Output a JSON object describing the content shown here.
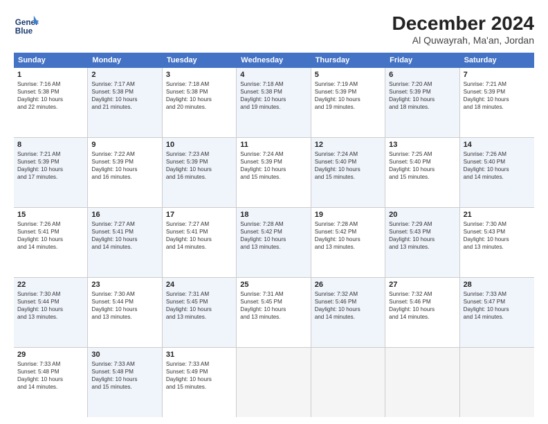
{
  "header": {
    "logo_line1": "General",
    "logo_line2": "Blue",
    "title": "December 2024",
    "subtitle": "Al Quwayrah, Ma'an, Jordan"
  },
  "days_of_week": [
    "Sunday",
    "Monday",
    "Tuesday",
    "Wednesday",
    "Thursday",
    "Friday",
    "Saturday"
  ],
  "weeks": [
    [
      {
        "day": "1",
        "text": "Sunrise: 7:16 AM\nSunset: 5:38 PM\nDaylight: 10 hours\nand 22 minutes.",
        "alt": false
      },
      {
        "day": "2",
        "text": "Sunrise: 7:17 AM\nSunset: 5:38 PM\nDaylight: 10 hours\nand 21 minutes.",
        "alt": true
      },
      {
        "day": "3",
        "text": "Sunrise: 7:18 AM\nSunset: 5:38 PM\nDaylight: 10 hours\nand 20 minutes.",
        "alt": false
      },
      {
        "day": "4",
        "text": "Sunrise: 7:18 AM\nSunset: 5:38 PM\nDaylight: 10 hours\nand 19 minutes.",
        "alt": true
      },
      {
        "day": "5",
        "text": "Sunrise: 7:19 AM\nSunset: 5:39 PM\nDaylight: 10 hours\nand 19 minutes.",
        "alt": false
      },
      {
        "day": "6",
        "text": "Sunrise: 7:20 AM\nSunset: 5:39 PM\nDaylight: 10 hours\nand 18 minutes.",
        "alt": true
      },
      {
        "day": "7",
        "text": "Sunrise: 7:21 AM\nSunset: 5:39 PM\nDaylight: 10 hours\nand 18 minutes.",
        "alt": false
      }
    ],
    [
      {
        "day": "8",
        "text": "Sunrise: 7:21 AM\nSunset: 5:39 PM\nDaylight: 10 hours\nand 17 minutes.",
        "alt": true
      },
      {
        "day": "9",
        "text": "Sunrise: 7:22 AM\nSunset: 5:39 PM\nDaylight: 10 hours\nand 16 minutes.",
        "alt": false
      },
      {
        "day": "10",
        "text": "Sunrise: 7:23 AM\nSunset: 5:39 PM\nDaylight: 10 hours\nand 16 minutes.",
        "alt": true
      },
      {
        "day": "11",
        "text": "Sunrise: 7:24 AM\nSunset: 5:39 PM\nDaylight: 10 hours\nand 15 minutes.",
        "alt": false
      },
      {
        "day": "12",
        "text": "Sunrise: 7:24 AM\nSunset: 5:40 PM\nDaylight: 10 hours\nand 15 minutes.",
        "alt": true
      },
      {
        "day": "13",
        "text": "Sunrise: 7:25 AM\nSunset: 5:40 PM\nDaylight: 10 hours\nand 15 minutes.",
        "alt": false
      },
      {
        "day": "14",
        "text": "Sunrise: 7:26 AM\nSunset: 5:40 PM\nDaylight: 10 hours\nand 14 minutes.",
        "alt": true
      }
    ],
    [
      {
        "day": "15",
        "text": "Sunrise: 7:26 AM\nSunset: 5:41 PM\nDaylight: 10 hours\nand 14 minutes.",
        "alt": false
      },
      {
        "day": "16",
        "text": "Sunrise: 7:27 AM\nSunset: 5:41 PM\nDaylight: 10 hours\nand 14 minutes.",
        "alt": true
      },
      {
        "day": "17",
        "text": "Sunrise: 7:27 AM\nSunset: 5:41 PM\nDaylight: 10 hours\nand 14 minutes.",
        "alt": false
      },
      {
        "day": "18",
        "text": "Sunrise: 7:28 AM\nSunset: 5:42 PM\nDaylight: 10 hours\nand 13 minutes.",
        "alt": true
      },
      {
        "day": "19",
        "text": "Sunrise: 7:28 AM\nSunset: 5:42 PM\nDaylight: 10 hours\nand 13 minutes.",
        "alt": false
      },
      {
        "day": "20",
        "text": "Sunrise: 7:29 AM\nSunset: 5:43 PM\nDaylight: 10 hours\nand 13 minutes.",
        "alt": true
      },
      {
        "day": "21",
        "text": "Sunrise: 7:30 AM\nSunset: 5:43 PM\nDaylight: 10 hours\nand 13 minutes.",
        "alt": false
      }
    ],
    [
      {
        "day": "22",
        "text": "Sunrise: 7:30 AM\nSunset: 5:44 PM\nDaylight: 10 hours\nand 13 minutes.",
        "alt": true
      },
      {
        "day": "23",
        "text": "Sunrise: 7:30 AM\nSunset: 5:44 PM\nDaylight: 10 hours\nand 13 minutes.",
        "alt": false
      },
      {
        "day": "24",
        "text": "Sunrise: 7:31 AM\nSunset: 5:45 PM\nDaylight: 10 hours\nand 13 minutes.",
        "alt": true
      },
      {
        "day": "25",
        "text": "Sunrise: 7:31 AM\nSunset: 5:45 PM\nDaylight: 10 hours\nand 13 minutes.",
        "alt": false
      },
      {
        "day": "26",
        "text": "Sunrise: 7:32 AM\nSunset: 5:46 PM\nDaylight: 10 hours\nand 14 minutes.",
        "alt": true
      },
      {
        "day": "27",
        "text": "Sunrise: 7:32 AM\nSunset: 5:46 PM\nDaylight: 10 hours\nand 14 minutes.",
        "alt": false
      },
      {
        "day": "28",
        "text": "Sunrise: 7:33 AM\nSunset: 5:47 PM\nDaylight: 10 hours\nand 14 minutes.",
        "alt": true
      }
    ],
    [
      {
        "day": "29",
        "text": "Sunrise: 7:33 AM\nSunset: 5:48 PM\nDaylight: 10 hours\nand 14 minutes.",
        "alt": false
      },
      {
        "day": "30",
        "text": "Sunrise: 7:33 AM\nSunset: 5:48 PM\nDaylight: 10 hours\nand 15 minutes.",
        "alt": true
      },
      {
        "day": "31",
        "text": "Sunrise: 7:33 AM\nSunset: 5:49 PM\nDaylight: 10 hours\nand 15 minutes.",
        "alt": false
      },
      {
        "day": "",
        "text": "",
        "alt": true,
        "empty": true
      },
      {
        "day": "",
        "text": "",
        "alt": false,
        "empty": true
      },
      {
        "day": "",
        "text": "",
        "alt": true,
        "empty": true
      },
      {
        "day": "",
        "text": "",
        "alt": false,
        "empty": true
      }
    ]
  ]
}
